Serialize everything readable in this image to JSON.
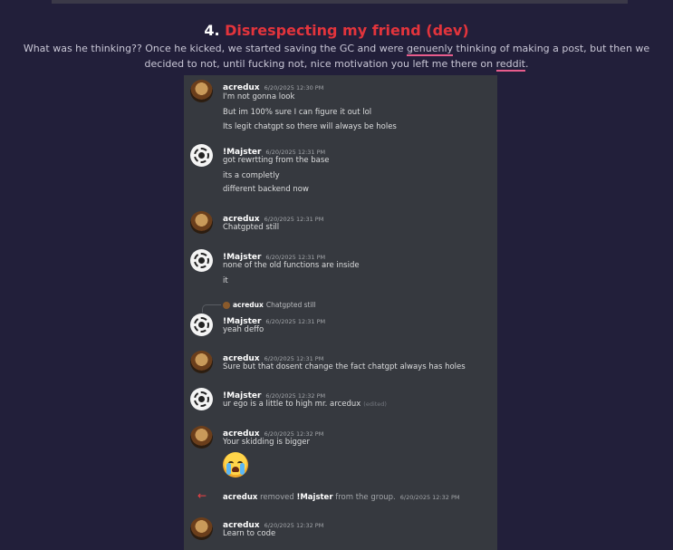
{
  "heading": {
    "number": "4.",
    "title": "Disrespecting my friend (dev)"
  },
  "description": {
    "part1": "What was he thinking?? Once he kicked, we started saving the GC and were ",
    "underlined1": "genuenly",
    "part2": " thinking of making a post, but then we decided to not, until fucking not, nice motivation you left me there on ",
    "underlined2": "reddit",
    "part3": "."
  },
  "messages": [
    {
      "author": "acredux",
      "time": "6/20/2025 12:30 PM",
      "lines": [
        "I'm not gonna look",
        "But im 100% sure I can figure it out lol",
        "Its legit chatgpt so there will always be holes"
      ]
    },
    {
      "author": "!Majster",
      "time": "6/20/2025 12:31 PM",
      "lines": [
        "got rewrtting from the base",
        "its a completly",
        "different backend now"
      ]
    },
    {
      "author": "acredux",
      "time": "6/20/2025 12:31 PM",
      "lines": [
        "Chatgpted still"
      ]
    },
    {
      "author": "!Majster",
      "time": "6/20/2025 12:31 PM",
      "lines": [
        "none of the old functions are inside",
        "it"
      ]
    },
    {
      "author": "!Majster",
      "time": "6/20/2025 12:31 PM",
      "lines": [
        "yeah deffo"
      ]
    },
    {
      "author": "acredux",
      "time": "6/20/2025 12:31 PM",
      "lines": [
        "Sure but that dosent change the fact chatgpt always has holes"
      ]
    },
    {
      "author": "!Majster",
      "time": "6/20/2025 12:32 PM",
      "lines": [
        "ur ego is a little to high mr. arcedux"
      ],
      "edited": "(edited)"
    },
    {
      "author": "acredux",
      "time": "6/20/2025 12:32 PM",
      "lines": [
        "Your skidding is bigger"
      ],
      "emoji": "loudly-crying-face"
    },
    {
      "author": "acredux",
      "time": "6/20/2025 12:32 PM",
      "lines": [
        "Learn to code"
      ]
    }
  ],
  "reply": {
    "author": "acredux",
    "text": "Chatgpted still"
  },
  "system": {
    "actor": "acredux",
    "action": "removed",
    "target": "!Majster",
    "suffix": "from the group.",
    "time": "6/20/2025 12:32 PM"
  },
  "colors": {
    "background": "#221f3a",
    "chat_bg": "#36393f",
    "accent_red": "#e3343c",
    "underline_pink": "#e85c8c"
  }
}
